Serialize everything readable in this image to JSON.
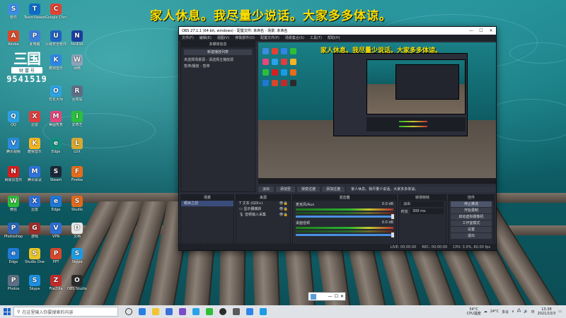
{
  "subtitle": "家人休息。我尽量少说话。大家多多体谅。",
  "desktop_icons": [
    {
      "label": "软件",
      "color": "#3c8de0",
      "glyph": "S"
    },
    {
      "label": "TeamViewer",
      "color": "#0e6cc8",
      "glyph": "T"
    },
    {
      "label": "Google Chrome",
      "color": "#e34133",
      "glyph": "C"
    },
    {
      "label": "Adobe",
      "color": "#d84a2b",
      "glyph": "A"
    },
    {
      "label": "此电脑",
      "color": "#3d7ed8",
      "glyph": "P"
    },
    {
      "label": "火绒安全软件",
      "color": "#1f62c2",
      "glyph": "U"
    },
    {
      "label": "NVIDIA",
      "color": "#1c3ea0",
      "glyph": "N"
    },
    {
      "label": "酷狗音乐",
      "color": "#2f86e6",
      "glyph": "K"
    },
    {
      "label": "网络",
      "color": "#8fa3b8",
      "glyph": "W"
    },
    {
      "label": "优化大师",
      "color": "#2da3e3",
      "glyph": "O"
    },
    {
      "label": "回收站",
      "color": "#5c6f85",
      "glyph": "R"
    },
    {
      "label": "QQ",
      "color": "#2aa2e8",
      "glyph": "Q"
    },
    {
      "label": "迅雷",
      "color": "#e03e3e",
      "glyph": "X"
    },
    {
      "label": "美图秀秀",
      "color": "#e8467d",
      "glyph": "M"
    },
    {
      "label": "爱奇艺",
      "color": "#2cbe3c",
      "glyph": "i"
    },
    {
      "label": "腾讯视频",
      "color": "#2a8be0",
      "glyph": "V"
    },
    {
      "label": "酷我音乐",
      "color": "#f4b521",
      "glyph": "K"
    },
    {
      "label": "Edge",
      "color": "#138c7e",
      "glyph": "e"
    },
    {
      "label": "LUX",
      "color": "#d8a832",
      "glyph": "L"
    },
    {
      "label": "网易云音乐",
      "color": "#d81e1e",
      "glyph": "N"
    },
    {
      "label": "腾讯会议",
      "color": "#2f73e0",
      "glyph": "M"
    },
    {
      "label": "Steam",
      "color": "#1b2838",
      "glyph": "S"
    },
    {
      "label": "Firefox",
      "color": "#e66b1a",
      "glyph": "F"
    },
    {
      "label": "微信",
      "color": "#2dbe3a",
      "glyph": "W"
    },
    {
      "label": "迅雷",
      "color": "#2f6ed8",
      "glyph": "X"
    },
    {
      "label": "Edge",
      "color": "#2077d6",
      "glyph": "e"
    },
    {
      "label": "Studio",
      "color": "#e06a1c",
      "glyph": "S"
    },
    {
      "label": "Photoshop",
      "color": "#2d65b8",
      "glyph": "P"
    },
    {
      "label": "游戏",
      "color": "#a02c2c",
      "glyph": "G"
    },
    {
      "label": "VPN",
      "color": "#2c6ed8",
      "glyph": "V"
    },
    {
      "label": "文档",
      "color": "#e6e6e6",
      "glyph": "D"
    },
    {
      "label": "Edge",
      "color": "#1f7bd8",
      "glyph": "e"
    },
    {
      "label": "Studio One",
      "color": "#e8c32a",
      "glyph": "S"
    },
    {
      "label": "PPT",
      "color": "#d8462c",
      "glyph": "P"
    },
    {
      "label": "Skype",
      "color": "#1c9be6",
      "glyph": "S"
    },
    {
      "label": "Photos",
      "color": "#5e6f84",
      "glyph": "P"
    },
    {
      "label": "Skype",
      "color": "#1c8fe0",
      "glyph": "S"
    },
    {
      "label": "FileZilla",
      "color": "#c22a2a",
      "glyph": "Z"
    },
    {
      "label": "OBS Studio",
      "color": "#2b2b2b",
      "glyph": "O"
    }
  ],
  "clock_widget": {
    "logo": "三国",
    "label": "财 富 号",
    "number": "9541519"
  },
  "obs": {
    "title": "OBS 27.1.1 (64-bit, windows) - 配置文件: 未命名 - 场景: 未命名",
    "window_buttons": [
      "—",
      "☐",
      "✕"
    ],
    "menu": [
      "文件(F)",
      "编辑(E)",
      "视图(V)",
      "停靠部件(D)",
      "配置文件(P)",
      "场景集合(S)",
      "工具(T)",
      "帮助(H)"
    ],
    "scenes_panel_title": "多媒体信息",
    "scenes_panel_button": "新建播放列表",
    "scenes_panel_note": "未选择场景源 - 请选择主播放源",
    "scenes_panel_note2": "暂停/播放 : 暂停",
    "preview_subtitle": "家人休息。我尽量少说话。大家多多体谅。",
    "controls": {
      "transition_label": "淡出",
      "mute_btn": "添加至",
      "fade_btn": "渐变过渡",
      "record_btn": "添加过渡",
      "preview_text": "家人休息。我尽量少说话。大家多多体谅。"
    },
    "scenes_dock": {
      "title": "场景",
      "items": [
        "眼目之前"
      ]
    },
    "sources_dock": {
      "title": "来源",
      "items": [
        "文本 (GDI+)",
        "显示器捕获",
        "音频输入采集"
      ]
    },
    "mixer_dock": {
      "title": "混音器",
      "channels": [
        {
          "name": "麦克风/Aux",
          "db": "0.0 dB"
        },
        {
          "name": "桌面音频",
          "db": "0.0 dB"
        }
      ]
    },
    "transitions_dock": {
      "title": "转场特效",
      "type": "淡出",
      "duration_label": "时长",
      "duration": "300 ms"
    },
    "controls_dock": {
      "title": "控件",
      "buttons": [
        "停止推流",
        "开始录制",
        "启动虚拟摄像机",
        "工作室模式",
        "设置",
        "退出"
      ]
    },
    "status": {
      "live": "LIVE: 00:00:00",
      "rec": "REC: 00:00:00",
      "cpu": "CPU: 3.0%, 60.00 fps"
    },
    "footer_glyphs": "+ − ⚙ ∧ ∨"
  },
  "taskbar": {
    "search_placeholder": "在这里输入你要搜索的内容",
    "weather_temp": "54°C",
    "weather_label": "CPU温度",
    "temp": "24°C",
    "weather_desc": "多云",
    "time": "13:38",
    "date": "2021/10/3"
  },
  "colors": {
    "accent": "#ffe000",
    "obs_bg": "#2b2e38",
    "selection": "#3a4c7a"
  }
}
